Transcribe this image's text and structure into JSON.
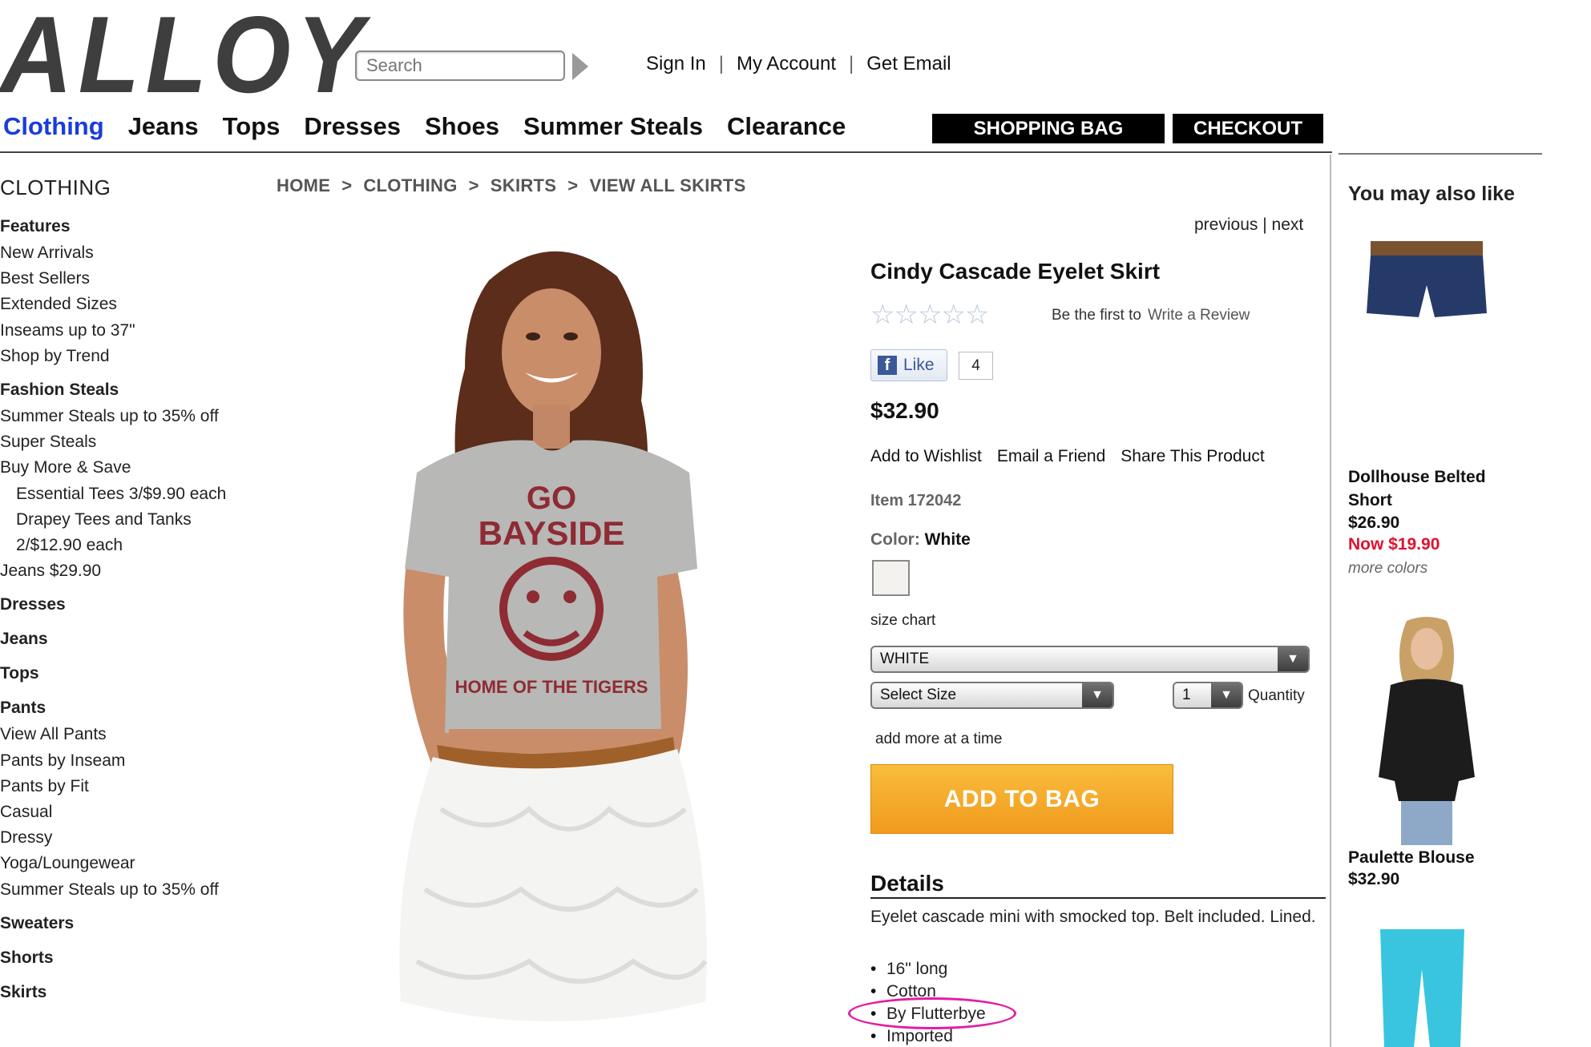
{
  "header": {
    "logo": "ALLOY",
    "search_placeholder": "Search",
    "account_links": [
      "Sign In",
      "My Account",
      "Get Email"
    ],
    "separator": "|",
    "nav": [
      "Clothing",
      "Jeans",
      "Tops",
      "Dresses",
      "Shoes",
      "Summer Steals",
      "Clearance"
    ],
    "shopping_bag": "SHOPPING BAG",
    "checkout": "CHECKOUT"
  },
  "left_nav": {
    "title": "CLOTHING",
    "items": [
      {
        "label": "Features",
        "type": "head"
      },
      {
        "label": "New Arrivals",
        "type": "link"
      },
      {
        "label": "Best Sellers",
        "type": "link"
      },
      {
        "label": "Extended Sizes",
        "type": "link"
      },
      {
        "label": "Inseams up to 37\"",
        "type": "link"
      },
      {
        "label": "Shop by Trend",
        "type": "link"
      },
      {
        "label": "Fashion Steals",
        "type": "head"
      },
      {
        "label": "Summer Steals up to 35% off",
        "type": "link"
      },
      {
        "label": "Super Steals",
        "type": "link"
      },
      {
        "label": "Buy More & Save",
        "type": "link"
      },
      {
        "label": "Essential Tees 3/$9.90 each",
        "type": "indent"
      },
      {
        "label": "Drapey Tees and Tanks",
        "type": "indent"
      },
      {
        "label": "2/$12.90 each",
        "type": "indent"
      },
      {
        "label": "Jeans $29.90",
        "type": "link"
      },
      {
        "label": "Dresses",
        "type": "head"
      },
      {
        "label": "Jeans",
        "type": "head"
      },
      {
        "label": "Tops",
        "type": "head"
      },
      {
        "label": "Pants",
        "type": "head"
      },
      {
        "label": "View All Pants",
        "type": "link"
      },
      {
        "label": "Pants by Inseam",
        "type": "link"
      },
      {
        "label": "Pants by Fit",
        "type": "link"
      },
      {
        "label": "Casual",
        "type": "link"
      },
      {
        "label": "Dressy",
        "type": "link"
      },
      {
        "label": "Yoga/Loungewear",
        "type": "link"
      },
      {
        "label": "Summer Steals up to 35% off",
        "type": "link"
      },
      {
        "label": "Sweaters",
        "type": "head"
      },
      {
        "label": "Shorts",
        "type": "head"
      },
      {
        "label": "Skirts",
        "type": "head"
      }
    ]
  },
  "breadcrumb": [
    "HOME",
    "CLOTHING",
    "SKIRTS",
    "VIEW ALL SKIRTS"
  ],
  "breadcrumb_sep": ">",
  "product_image": {
    "shirt_line1": "GO",
    "shirt_line2": "BAYSIDE",
    "shirt_line3": "HOME OF THE TIGERS"
  },
  "product": {
    "previous": "previous",
    "next": "next",
    "title": "Cindy Cascade Eyelet Skirt",
    "stars": "☆☆☆☆☆",
    "review_prompt": "Be the first to",
    "review_link": "Write a Review",
    "like_label": "Like",
    "like_count": "4",
    "price": "$32.90",
    "actions": [
      "Add to Wishlist",
      "Email a Friend",
      "Share This Product"
    ],
    "item": "Item 172042",
    "color_label": "Color:",
    "color_value": "White",
    "size_chart": "size chart",
    "color_select": "WHITE",
    "size_select": "Select Size",
    "quantity_value": "1",
    "quantity_label": "Quantity",
    "add_more": "add more at a time",
    "add_to_bag": "ADD TO BAG",
    "details_title": "Details",
    "details_desc": "Eyelet cascade mini with smocked top. Belt included. Lined.",
    "details_list": [
      "16\" long",
      "Cotton",
      "By Flutterbye",
      "Imported"
    ],
    "highlight_color": "#e21ea3"
  },
  "recommendations": {
    "title": "You may also like",
    "items": [
      {
        "name_line1": "Dollhouse Belted",
        "name_line2": "Short",
        "price": "$26.90",
        "sale": "Now $19.90",
        "more": "more colors"
      },
      {
        "name_line1": "Paulette Blouse",
        "price": "$32.90"
      }
    ]
  },
  "colors": {
    "nav_active": "#1a3cdc",
    "sale": "#e0102f",
    "add_to_bag": "#f5a623"
  }
}
